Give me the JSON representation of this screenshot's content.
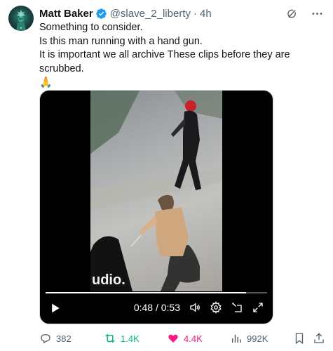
{
  "author": {
    "name": "Matt Baker",
    "handle": "@slave_2_liberty",
    "separator": "·",
    "time": "4h",
    "verified": true,
    "avatar_icon": "statue-of-liberty-avatar"
  },
  "post": {
    "lines": [
      "Something to consider.",
      "Is this man running with a hand gun.",
      "It is important we all archive These clips before they are",
      "scrubbed."
    ],
    "emoji": "🙏"
  },
  "video": {
    "current_time": "0:48",
    "duration": "0:53",
    "time_separator": " / ",
    "progress_fraction": 0.906,
    "watermark": "udio."
  },
  "actions": {
    "replies": "382",
    "reposts": "1.4K",
    "likes": "4.4K",
    "views": "992K"
  },
  "colors": {
    "verified": "#1d9bf0",
    "repost_active": "#00ba7c",
    "like_active": "#f91880",
    "muted": "#536471"
  }
}
